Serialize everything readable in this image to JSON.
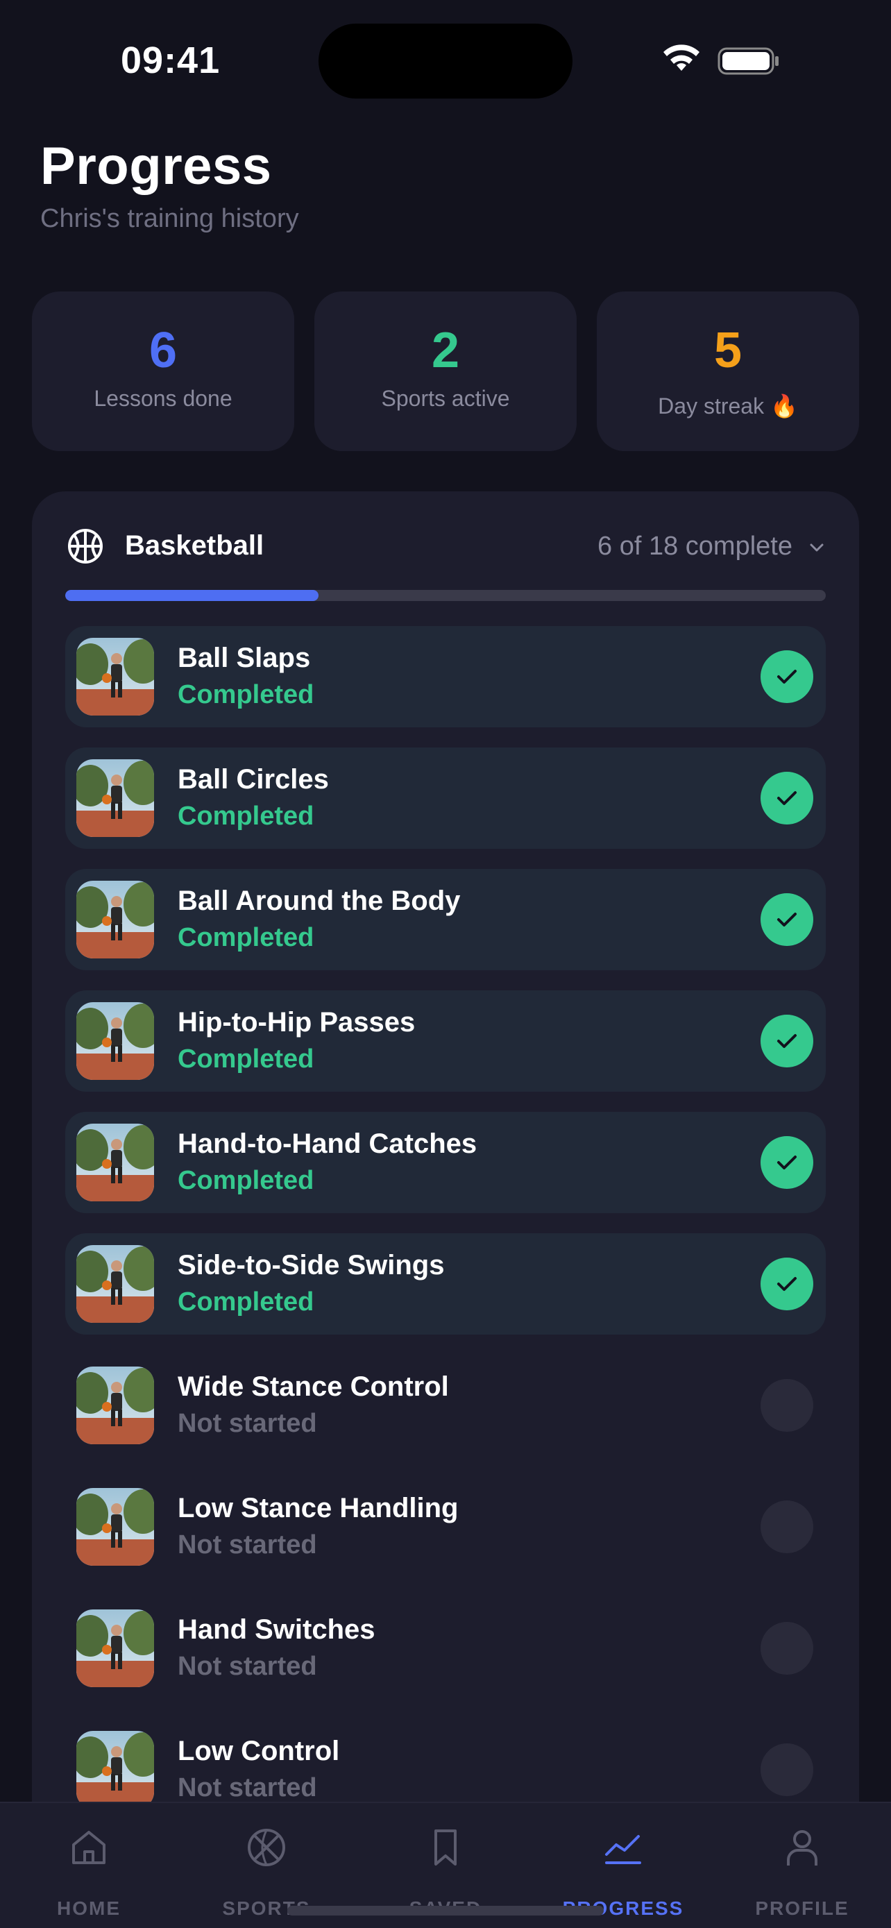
{
  "status_bar": {
    "time": "09:41"
  },
  "header": {
    "title": "Progress",
    "subtitle": "Chris's training history"
  },
  "stats": [
    {
      "value": "6",
      "label": "Lessons done",
      "color": "#4f6ff5"
    },
    {
      "value": "2",
      "label": "Sports active",
      "color": "#35c98e"
    },
    {
      "value": "5",
      "label": "Day streak",
      "emoji": "🔥",
      "color": "#f5a01a"
    }
  ],
  "sport": {
    "name": "Basketball",
    "icon": "basketball-icon",
    "count": "6 of 18 complete",
    "progress_fraction": 0.333,
    "lessons": [
      {
        "title": "Ball Slaps",
        "status": "Completed",
        "done": true
      },
      {
        "title": "Ball Circles",
        "status": "Completed",
        "done": true
      },
      {
        "title": "Ball Around the Body",
        "status": "Completed",
        "done": true
      },
      {
        "title": "Hip-to-Hip Passes",
        "status": "Completed",
        "done": true
      },
      {
        "title": "Hand-to-Hand Catches",
        "status": "Completed",
        "done": true
      },
      {
        "title": "Side-to-Side Swings",
        "status": "Completed",
        "done": true
      },
      {
        "title": "Wide Stance Control",
        "status": "Not started",
        "done": false
      },
      {
        "title": "Low Stance Handling",
        "status": "Not started",
        "done": false
      },
      {
        "title": "Hand Switches",
        "status": "Not started",
        "done": false
      },
      {
        "title": "Low Control",
        "status": "Not started",
        "done": false
      }
    ]
  },
  "tabs": [
    {
      "label": "HOME",
      "icon": "home-icon",
      "active": false
    },
    {
      "label": "SPORTS",
      "icon": "basketball-icon",
      "active": false
    },
    {
      "label": "SAVED",
      "icon": "bookmark-icon",
      "active": false
    },
    {
      "label": "PROGRESS",
      "icon": "chart-icon",
      "active": true
    },
    {
      "label": "PROFILE",
      "icon": "person-icon",
      "active": false
    }
  ],
  "colors": {
    "accent": "#5672f6",
    "success": "#35c98e",
    "streak": "#f5a01a",
    "background": "#12121d",
    "card": "#1d1d2d"
  }
}
